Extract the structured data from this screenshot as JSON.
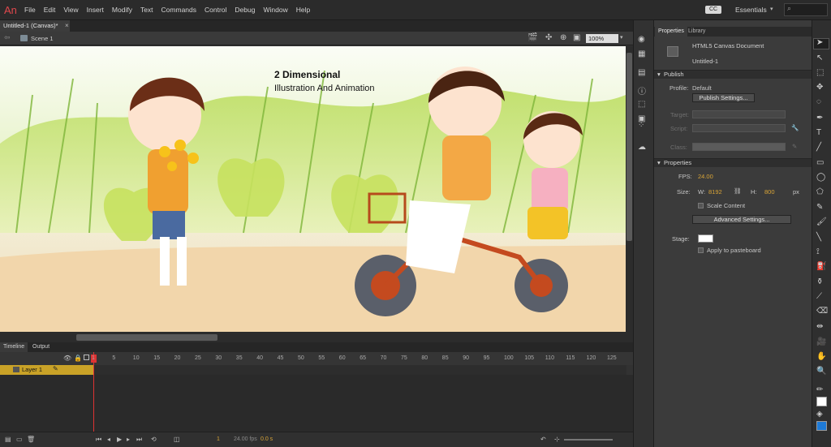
{
  "app": {
    "logo": "An"
  },
  "menu": [
    "File",
    "Edit",
    "View",
    "Insert",
    "Modify",
    "Text",
    "Commands",
    "Control",
    "Debug",
    "Window",
    "Help"
  ],
  "workspace": {
    "label": "Essentials",
    "sync_badge": "CC"
  },
  "document": {
    "tab": "Untitled-1 (Canvas)*",
    "close": "×",
    "scene": "Scene 1",
    "zoom": "100%"
  },
  "stage": {
    "title": "2 Dimensional",
    "subtitle": "Illustration And Animation"
  },
  "timeline": {
    "tabs": [
      "Timeline",
      "Output"
    ],
    "layer": "Layer 1",
    "ruler": [
      "1",
      "5",
      "10",
      "15",
      "20",
      "25",
      "30",
      "35",
      "40",
      "45",
      "50",
      "55",
      "60",
      "65",
      "70",
      "75",
      "80",
      "85",
      "90",
      "95",
      "100",
      "105",
      "110",
      "115",
      "120",
      "125"
    ],
    "current_frame": "1",
    "fps": "24.00 fps",
    "time": "0.0 s"
  },
  "properties": {
    "tabs": [
      "Properties",
      "Library"
    ],
    "doc_type": "HTML5 Canvas Document",
    "doc_name": "Untitled-1",
    "publish_header": "Publish",
    "profile_label": "Profile:",
    "profile_value": "Default",
    "publish_settings": "Publish Settings...",
    "target_label": "Target:",
    "script_label": "Script:",
    "class_label": "Class:",
    "properties_header": "Properties",
    "fps_label": "FPS:",
    "fps_value": "24.00",
    "size_label": "Size:",
    "w_label": "W:",
    "w_value": "8192",
    "h_label": "H:",
    "h_value": "800",
    "unit": "px",
    "scale_content": "Scale Content",
    "advanced_settings": "Advanced Settings...",
    "stage_label": "Stage:",
    "apply_pasteboard": "Apply to pasteboard"
  },
  "colors": {
    "stroke": "#ffffff",
    "fill": "#1e7ad6",
    "accent": "#d8a437",
    "stage": "#ffffff"
  }
}
